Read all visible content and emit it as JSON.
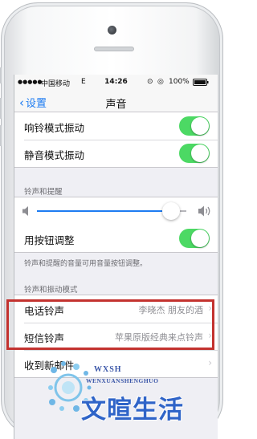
{
  "status_bar": {
    "carrier": "中国移动",
    "network": "E",
    "time": "14:26",
    "battery": "100%"
  },
  "nav": {
    "back_label": "设置",
    "title": "声音"
  },
  "vibration": {
    "items": [
      {
        "label": "响铃模式振动",
        "enabled": true
      },
      {
        "label": "静音模式振动",
        "enabled": true
      }
    ]
  },
  "ringer": {
    "header": "铃声和提醒",
    "volume_level": 0.9,
    "button_adjust_label": "用按钮调整",
    "button_adjust_enabled": true,
    "footer": "铃声和提醒的音量可用音量按钮调整。"
  },
  "sounds": {
    "header": "铃声和振动模式",
    "items": [
      {
        "label": "电话铃声",
        "value": "李晓杰 朋友的酒"
      },
      {
        "label": "短信铃声",
        "value": "苹果原版经典来点铃声"
      },
      {
        "label": "收到新邮件",
        "value": ""
      }
    ]
  },
  "watermark": {
    "top": "WXSH",
    "sub": "WENXUANSHENGHUO",
    "main": "文暄生活"
  },
  "colors": {
    "accent": "#1e7cf2",
    "toggle_on": "#4cd964",
    "highlight": "#c3322f",
    "watermark": "#2f64c8"
  }
}
